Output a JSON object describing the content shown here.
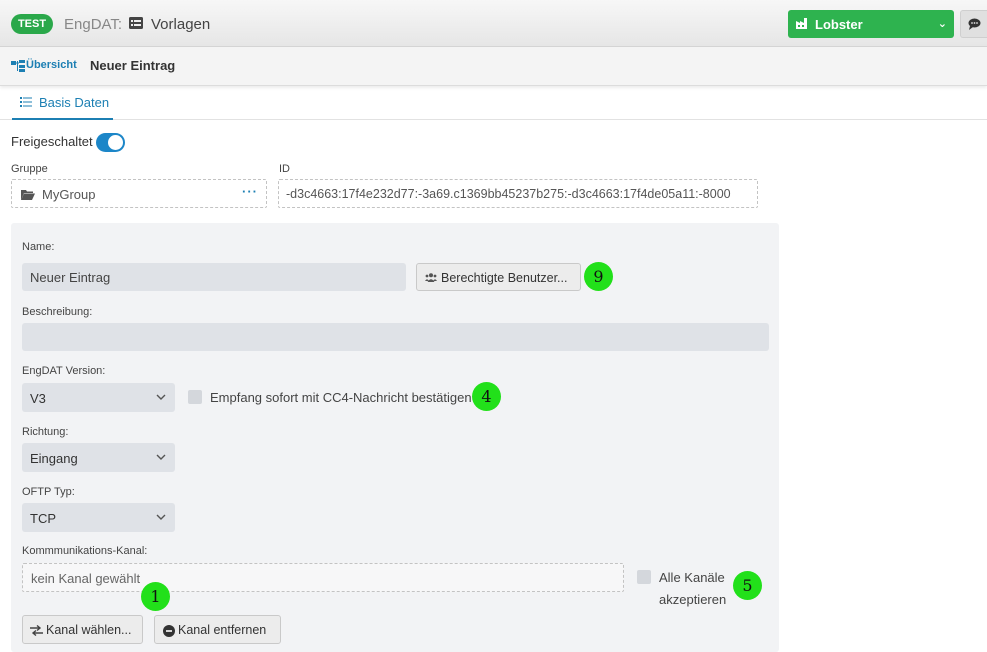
{
  "header": {
    "env_badge": "TEST",
    "app_name": "EngDAT:",
    "section": "Vorlagen",
    "section_icon": "table-list-icon",
    "account_menu": "Lobster",
    "account_icon": "factory-icon",
    "chat_icon": "comment-icon"
  },
  "breadcrumb": {
    "overview_label": "Übersicht",
    "overview_icon": "sitemap-icon",
    "current": "Neuer Eintrag"
  },
  "tabs": [
    {
      "label": "Basis Daten",
      "icon": "list-icon",
      "active": true
    }
  ],
  "form": {
    "enabled_label": "Freigeschaltet",
    "enabled": true,
    "group_label": "Gruppe",
    "group_value": "MyGroup",
    "group_more": "···",
    "id_label": "ID",
    "id_value": "-d3c4663:17f4e232d77:-3a69.c1369bb45237b275:-d3c4663:17f4de05a11:-8000",
    "name_label": "Name:",
    "name_value": "Neuer Eintrag",
    "authorized_users_button": "Berechtigte Benutzer...",
    "description_label": "Beschreibung:",
    "description_value": "",
    "version_label": "EngDAT Version:",
    "version_value": "V3",
    "cc4_checkbox_label": "Empfang sofort mit CC4-Nachricht bestätigen",
    "cc4_checked": false,
    "direction_label": "Richtung:",
    "direction_value": "Eingang",
    "oftp_label": "OFTP Typ:",
    "oftp_value": "TCP",
    "channel_label": "Kommmunikations-Kanal:",
    "channel_value": "kein Kanal gewählt",
    "all_channels_label_1": "Alle Kanäle",
    "all_channels_label_2": "akzeptieren",
    "all_channels_checked": false,
    "choose_channel_button": "Kanal wählen...",
    "remove_channel_button": "Kanal entfernen"
  },
  "markers": {
    "m9": "9",
    "m4": "4",
    "m5": "5",
    "m1": "1"
  },
  "colors": {
    "accent": "#1c7fb3",
    "success": "#2eb34f",
    "marker": "#22e01a"
  }
}
